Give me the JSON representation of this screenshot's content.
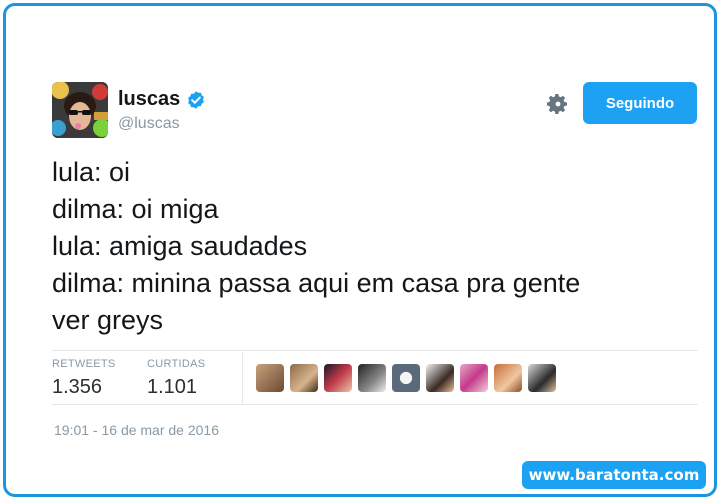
{
  "user": {
    "display_name": "luscas",
    "handle": "@luscas",
    "verified": true,
    "avatar_icon": "profile-photo"
  },
  "actions": {
    "settings_icon": "gear-icon",
    "follow_label": "Seguindo"
  },
  "tweet": {
    "lines": [
      "lula: oi",
      "dilma: oi miga",
      "lula: amiga saudades",
      "dilma: minina passa aqui em casa pra gente",
      "ver greys"
    ]
  },
  "stats": {
    "retweets_label": "RETWEETS",
    "retweets_value": "1.356",
    "likes_label": "CURTIDAS",
    "likes_value": "1.101"
  },
  "liked_by_avatars": [
    "avatar",
    "avatar",
    "avatar",
    "avatar",
    "avatar",
    "avatar",
    "avatar",
    "avatar",
    "avatar"
  ],
  "timestamp": "19:01 - 16 de mar de 2016",
  "watermark": "www.baratonta.com",
  "colors": {
    "accent": "#1da1f2",
    "frame": "#1b95e0",
    "text": "#14171a",
    "muted": "#8899a6"
  }
}
